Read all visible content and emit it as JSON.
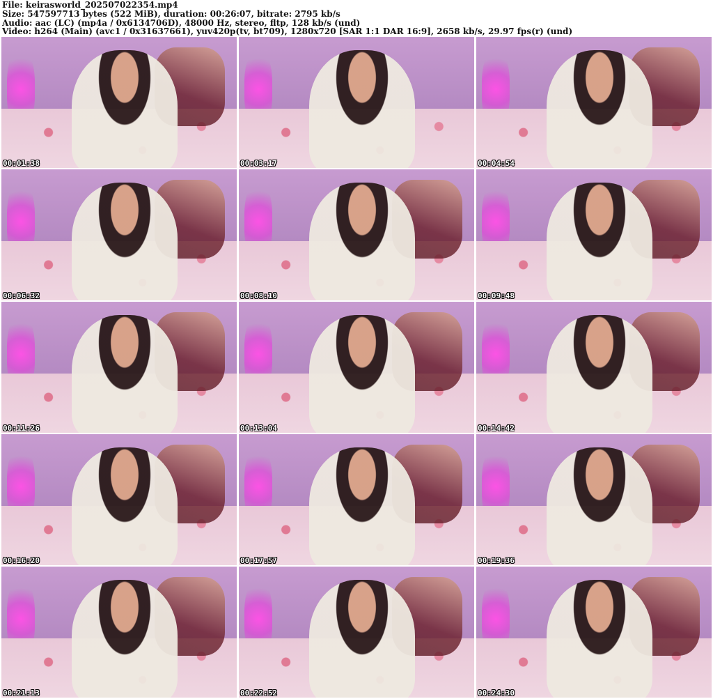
{
  "header": {
    "file": "File: keirasworld_202507022354.mp4",
    "size": "Size: 547597713 bytes (522 MiB), duration: 00:26:07, bitrate: 2795 kb/s",
    "audio": "Audio: aac (LC) (mp4a / 0x6134706D), 48000 Hz, stereo, fltp, 128 kb/s (und)",
    "video": "Video: h264 (Main) (avc1 / 0x31637661), yuv420p(tv, bt709), 1280x720 [SAR 1:1 DAR 16:9], 2658 kb/s, 29.97 fps(r) (und)"
  },
  "thumbnails": [
    {
      "timestamp": "00:01:38"
    },
    {
      "timestamp": "00:03:17"
    },
    {
      "timestamp": "00:04:54"
    },
    {
      "timestamp": "00:06:32"
    },
    {
      "timestamp": "00:08:10"
    },
    {
      "timestamp": "00:09:48"
    },
    {
      "timestamp": "00:11:26"
    },
    {
      "timestamp": "00:13:04"
    },
    {
      "timestamp": "00:14:42"
    },
    {
      "timestamp": "00:16:20"
    },
    {
      "timestamp": "00:17:57"
    },
    {
      "timestamp": "00:19:36"
    },
    {
      "timestamp": "00:21:13"
    },
    {
      "timestamp": "00:22:52"
    },
    {
      "timestamp": "00:24:30"
    }
  ]
}
